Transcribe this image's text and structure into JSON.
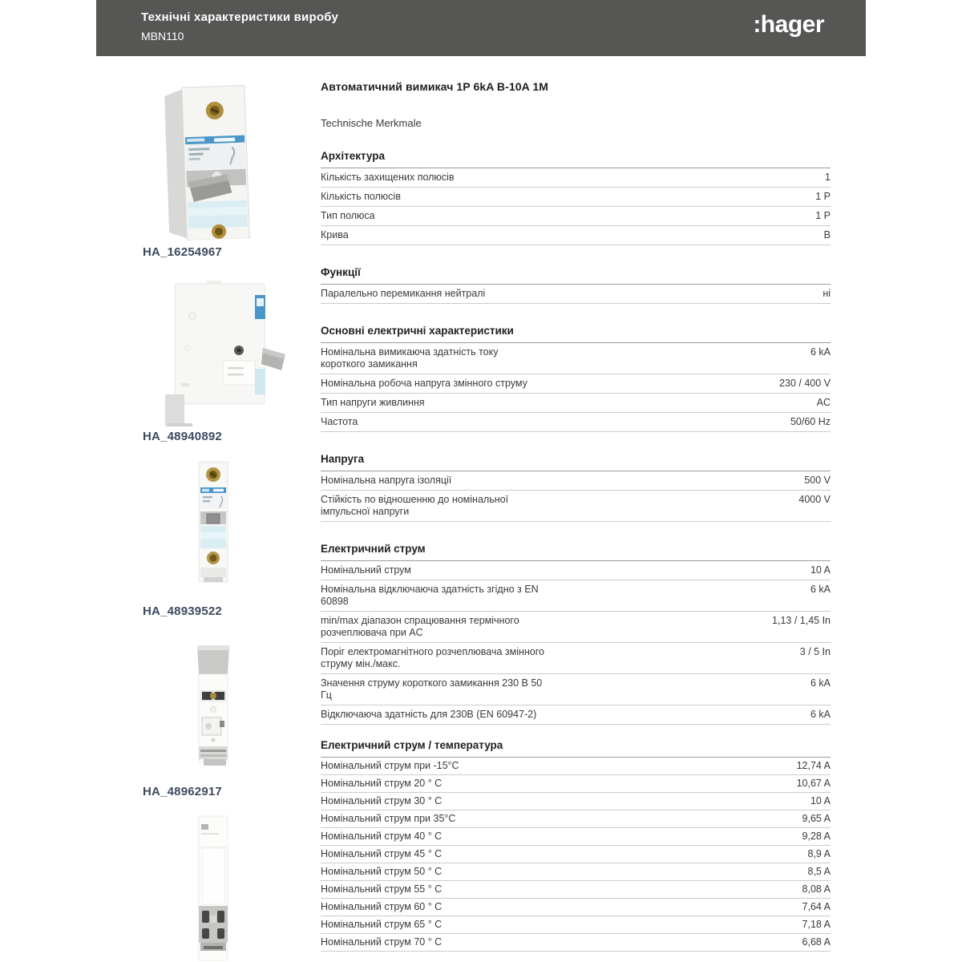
{
  "header": {
    "title": "Технічні характеристики виробу",
    "subtitle": "MBN110",
    "logo": ":hager"
  },
  "brand_colors": {
    "header_bg": "#565655",
    "logo_text": "#ffffff",
    "caption_text": "#3e4a5f",
    "product_label_blue": "#4a96c8"
  },
  "images": [
    {
      "caption": "HA_16254967"
    },
    {
      "caption": "HA_48940892"
    },
    {
      "caption": "HA_48939522"
    },
    {
      "caption": "HA_48962917"
    },
    {
      "caption": ""
    }
  ],
  "product": {
    "title": "Автоматичний вимикач 1P 6kA B-10A 1M",
    "subtitle": "Technische Merkmale"
  },
  "sections": [
    {
      "title": "Архітектура",
      "rows": [
        {
          "label": "Кількість захищених полюсів",
          "value": "1"
        },
        {
          "label": "Кількість полюсів",
          "value": "1 P"
        },
        {
          "label": "Тип полюса",
          "value": "1 P"
        },
        {
          "label": "Крива",
          "value": "B"
        }
      ]
    },
    {
      "title": "Функції",
      "rows": [
        {
          "label": "Паралельно перемикання нейтралі",
          "value": "ні"
        }
      ]
    },
    {
      "title": "Основні електричні характеристики",
      "rows": [
        {
          "label": "Номінальна вимикаюча здатність току\nкороткого замикання",
          "value": "6 kA"
        },
        {
          "label": "Номінальна робоча напруга змінного струму",
          "value": "230 / 400 V"
        },
        {
          "label": "Тип напруги живлиння",
          "value": "AC"
        },
        {
          "label": "Частота",
          "value": "50/60 Hz"
        }
      ]
    },
    {
      "title": "Напруга",
      "rows": [
        {
          "label": "Номінальна напруга ізоляції",
          "value": "500 V"
        },
        {
          "label": "Стійкість по відношенню до номінальної\nімпульсної напруги",
          "value": "4000 V"
        }
      ]
    },
    {
      "title": "Електричний струм",
      "rows": [
        {
          "label": "Номінальний струм",
          "value": "10 A"
        },
        {
          "label": "Номінальна відключаюча здатність згідно з EN\n60898",
          "value": "6 kA"
        },
        {
          "label": "min/max діапазон спрацювання термічного\nрозчеплювача при AC",
          "value": "1,13 / 1,45 In"
        },
        {
          "label": "Поріг електромагнітного розчеплювача змінного\nструму мін./макс.",
          "value": "3 / 5 In"
        },
        {
          "label": "Значення струму короткого замикання 230 В 50\nГц",
          "value": "6 kA"
        },
        {
          "label": "Відключаюча здатність для 230В (EN 60947-2)",
          "value": "6 kA"
        }
      ]
    },
    {
      "title": "Електричний струм / температура",
      "rows": [
        {
          "label": "Номінальний струм при -15°C",
          "value": "12,74 A"
        },
        {
          "label": "Номінальний струм 20 ° C",
          "value": "10,67 A"
        },
        {
          "label": "Номінальний струм 30 ° C",
          "value": "10 A"
        },
        {
          "label": "Номінальний струм при 35°C",
          "value": "9,65 A"
        },
        {
          "label": "Номінальний струм 40 ° C",
          "value": "9,28 A"
        },
        {
          "label": "Номінальний струм 45 ° C",
          "value": "8,9 A"
        },
        {
          "label": "Номінальний струм 50 ° C",
          "value": "8,5 A"
        },
        {
          "label": "Номінальний струм 55 ° C",
          "value": "8,08 A"
        },
        {
          "label": "Номінальний струм 60 ° C",
          "value": "7,64 A"
        },
        {
          "label": "Номінальний струм 65 ° C",
          "value": "7,18 A"
        },
        {
          "label": "Номінальний струм 70 ° C",
          "value": "6,68 A"
        }
      ]
    }
  ]
}
